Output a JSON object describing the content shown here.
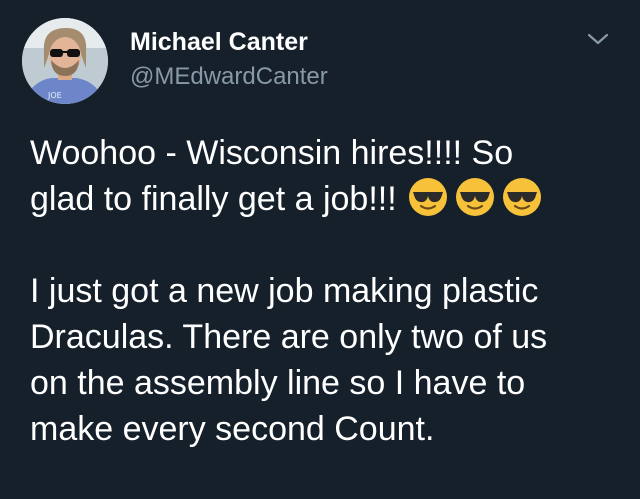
{
  "tweet": {
    "author_name": "Michael Canter",
    "author_handle": "@MEdwardCanter",
    "avatar_shirt_text": "JOE",
    "paragraph1_line1": "Woohoo - Wisconsin hires!!!! So",
    "paragraph1_line2": "glad to finally get a job!!!",
    "paragraph1_emojis": [
      "sunglasses-face",
      "sunglasses-face",
      "sunglasses-face"
    ],
    "paragraph2_lines": [
      "I just got a new job making plastic",
      "Draculas. There are only two of us",
      "on the assembly line so I have to",
      "make every second Count."
    ]
  },
  "colors": {
    "background": "#15202b",
    "text": "#ffffff",
    "secondary_text": "#8899a6",
    "emoji_face": "#f7c23a"
  },
  "icons": {
    "menu": "chevron-down-icon"
  }
}
